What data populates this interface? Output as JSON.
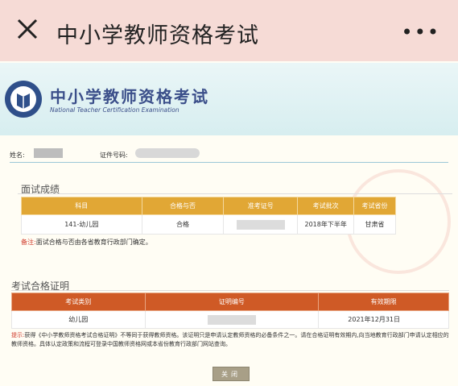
{
  "appbar": {
    "title": "中小学教师资格考试",
    "more": "•••"
  },
  "banner": {
    "title_cn": "中小学教师资格考试",
    "title_en": "National Teacher Certification Examination"
  },
  "identity": {
    "name_label": "姓名:",
    "id_label": "证件号码:"
  },
  "interview": {
    "title": "面试成绩",
    "headers": [
      "科目",
      "合格与否",
      "准考证号",
      "考试批次",
      "考试省份"
    ],
    "row": {
      "subject": "141-幼儿园",
      "result": "合格",
      "batch": "2018年下半年",
      "province": "甘肃省"
    },
    "note_label": "备注:",
    "note_text": "面试合格与否由各省教育行政部门确定。"
  },
  "certificate": {
    "title": "考试合格证明",
    "headers": [
      "考试类别",
      "证明编号",
      "有效期限"
    ],
    "row": {
      "category": "幼儿园",
      "valid_until": "2021年12月31日"
    },
    "tip_label": "提示:",
    "tip_text": "获得《中小学教师资格考试合格证明》不等同于获得教师资格。该证明只是申请认定教师资格的必备条件之一。请在合格证明有效期内,向当地教育行政部门申请认定相应的教师资格。具体认定政策和流程可登录中国教师资格网或本省份教育行政部门网站查询。"
  },
  "buttons": {
    "close": "关闭"
  },
  "colors": {
    "appbar_bg": "#f6dbd6",
    "interview_header": "#e1a735",
    "certificate_header": "#cf5a26",
    "note_red": "#d03a2a"
  }
}
